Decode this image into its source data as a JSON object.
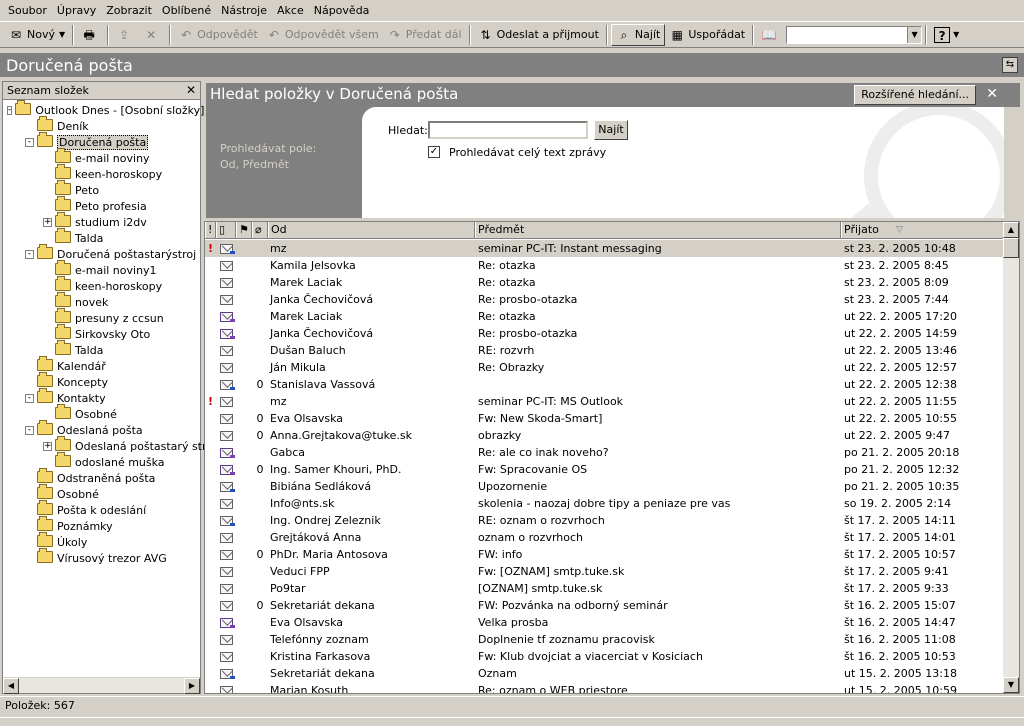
{
  "menu": [
    "Soubor",
    "Úpravy",
    "Zobrazit",
    "Oblíbené",
    "Nástroje",
    "Akce",
    "Nápověda"
  ],
  "toolbar": {
    "new_label": "Nový",
    "reply_label": "Odpovědět",
    "reply_all_label": "Odpovědět všem",
    "forward_label": "Předat dál",
    "send_receive_label": "Odeslat a přijmout",
    "find_label": "Najít",
    "organize_label": "Uspořádat",
    "address_combo_value": ""
  },
  "view_title": "Doručená pošta",
  "folder_pane": {
    "title": "Seznam složek",
    "items": [
      {
        "label": "Outlook Dnes - [Osobní složky]",
        "level": 0,
        "expander": "-",
        "icon": "outlook-today-icon"
      },
      {
        "label": "Deník",
        "level": 1,
        "expander": "",
        "icon": "journal-icon"
      },
      {
        "label": "Doručená pošta",
        "level": 1,
        "expander": "-",
        "icon": "inbox-icon",
        "selected": true
      },
      {
        "label": "e-mail noviny",
        "level": 2,
        "expander": "",
        "icon": "folder-icon"
      },
      {
        "label": "keen-horoskopy",
        "level": 2,
        "expander": "",
        "icon": "folder-icon"
      },
      {
        "label": "Peto",
        "level": 2,
        "expander": "",
        "icon": "folder-icon"
      },
      {
        "label": "Peto profesia",
        "level": 2,
        "expander": "",
        "icon": "folder-icon"
      },
      {
        "label": "studium i2dv",
        "level": 2,
        "expander": "+",
        "icon": "folder-icon"
      },
      {
        "label": "Talda",
        "level": 2,
        "expander": "",
        "icon": "folder-icon"
      },
      {
        "label": "Doručená poštastarýstroj",
        "level": 1,
        "expander": "-",
        "icon": "folder-icon"
      },
      {
        "label": "e-mail noviny1",
        "level": 2,
        "expander": "",
        "icon": "folder-icon"
      },
      {
        "label": "keen-horoskopy",
        "level": 2,
        "expander": "",
        "icon": "folder-icon"
      },
      {
        "label": "novek",
        "level": 2,
        "expander": "",
        "icon": "folder-icon"
      },
      {
        "label": "presuny z ccsun",
        "level": 2,
        "expander": "",
        "icon": "folder-icon"
      },
      {
        "label": "Sirkovsky Oto",
        "level": 2,
        "expander": "",
        "icon": "folder-icon"
      },
      {
        "label": "Talda",
        "level": 2,
        "expander": "",
        "icon": "folder-icon"
      },
      {
        "label": "Kalendář",
        "level": 1,
        "expander": "",
        "icon": "calendar-icon"
      },
      {
        "label": "Koncepty",
        "level": 1,
        "expander": "",
        "icon": "drafts-icon"
      },
      {
        "label": "Kontakty",
        "level": 1,
        "expander": "-",
        "icon": "contacts-icon"
      },
      {
        "label": "Osobné",
        "level": 2,
        "expander": "",
        "icon": "contacts-icon"
      },
      {
        "label": "Odeslaná pošta",
        "level": 1,
        "expander": "-",
        "icon": "folder-icon"
      },
      {
        "label": "Odeslaná poštastarý stro",
        "level": 2,
        "expander": "+",
        "icon": "folder-icon"
      },
      {
        "label": "odoslané muška",
        "level": 2,
        "expander": "",
        "icon": "folder-icon"
      },
      {
        "label": "Odstraněná pošta",
        "level": 1,
        "expander": "",
        "icon": "deleted-items-icon"
      },
      {
        "label": "Osobné",
        "level": 1,
        "expander": "",
        "icon": "contacts-icon"
      },
      {
        "label": "Pošta k odeslání",
        "level": 1,
        "expander": "",
        "icon": "outbox-icon"
      },
      {
        "label": "Poznámky",
        "level": 1,
        "expander": "",
        "icon": "notes-icon"
      },
      {
        "label": "Úkoly",
        "level": 1,
        "expander": "",
        "icon": "tasks-icon"
      },
      {
        "label": "Vírusový trezor AVG",
        "level": 1,
        "expander": "",
        "icon": "folder-icon"
      }
    ]
  },
  "find": {
    "title": "Hledat položky v Doručená pošta",
    "advanced_label": "Rozšířené hledání...",
    "search_in_label": "Prohledávat pole:",
    "search_in_fields": "Od, Předmět",
    "find_label": "Hledat:",
    "find_value": "",
    "find_button": "Najít",
    "fulltext_label": "Prohledávat celý text zprávy",
    "fulltext_checked": true
  },
  "columns": {
    "importance": "!",
    "icon": "",
    "flag": "",
    "attachment": "",
    "from": "Od",
    "subject": "Předmět",
    "received": "Přijato"
  },
  "messages": [
    {
      "imp": "!",
      "icon": "forwarded",
      "att": "",
      "from": "mz",
      "subject": "seminar PC-IT:  Instant messaging",
      "date": "st 23. 2. 2005 10:48",
      "selected": true
    },
    {
      "imp": "",
      "icon": "read",
      "att": "",
      "from": "Kamila Jelsovka",
      "subject": "Re: otazka",
      "date": "st 23. 2. 2005 8:45"
    },
    {
      "imp": "",
      "icon": "read",
      "att": "",
      "from": "Marek Laciak",
      "subject": "Re: otazka",
      "date": "st 23. 2. 2005 8:09"
    },
    {
      "imp": "",
      "icon": "read",
      "att": "",
      "from": "Janka Čechovičová",
      "subject": "Re: prosbo-otazka",
      "date": "st 23. 2. 2005 7:44"
    },
    {
      "imp": "",
      "icon": "replied",
      "att": "",
      "from": "Marek Laciak",
      "subject": "Re: otazka",
      "date": "ut 22. 2. 2005 17:20"
    },
    {
      "imp": "",
      "icon": "replied",
      "att": "",
      "from": "Janka Čechovičová",
      "subject": "Re: prosbo-otazka",
      "date": "ut 22. 2. 2005 14:59"
    },
    {
      "imp": "",
      "icon": "read",
      "att": "",
      "from": "Dušan Baluch",
      "subject": "RE: rozvrh",
      "date": "ut 22. 2. 2005 13:46"
    },
    {
      "imp": "",
      "icon": "read",
      "att": "",
      "from": "Ján Mikula",
      "subject": "Re: Obrazky",
      "date": "ut 22. 2. 2005 12:57"
    },
    {
      "imp": "",
      "icon": "forwarded",
      "att": "0",
      "from": "Stanislava Vassová",
      "subject": "",
      "date": "ut 22. 2. 2005 12:38"
    },
    {
      "imp": "!",
      "icon": "read",
      "att": "",
      "from": "mz",
      "subject": "seminar PC-IT: MS Outlook",
      "date": "ut 22. 2. 2005 11:55"
    },
    {
      "imp": "",
      "icon": "read",
      "att": "0",
      "from": "Eva Olsavska",
      "subject": "Fw: New Skoda-Smart]",
      "date": "ut 22. 2. 2005 10:55"
    },
    {
      "imp": "",
      "icon": "read",
      "att": "0",
      "from": "Anna.Grejtakova@tuke.sk",
      "subject": "obrazky",
      "date": "ut 22. 2. 2005 9:47"
    },
    {
      "imp": "",
      "icon": "replied",
      "att": "",
      "from": "Gabca",
      "subject": "Re: ale co inak noveho?",
      "date": "po 21. 2. 2005 20:18"
    },
    {
      "imp": "",
      "icon": "replied",
      "att": "0",
      "from": "Ing. Samer Khouri, PhD.",
      "subject": "Fw: Spracovanie OS",
      "date": "po 21. 2. 2005 12:32"
    },
    {
      "imp": "",
      "icon": "forwarded",
      "att": "",
      "from": "Bibiána Sedláková",
      "subject": "Upozornenie",
      "date": "po 21. 2. 2005 10:35"
    },
    {
      "imp": "",
      "icon": "read",
      "att": "",
      "from": "Info@nts.sk",
      "subject": "skolenia - naozaj dobre tipy a peniaze pre vas",
      "date": "so 19. 2. 2005 2:14"
    },
    {
      "imp": "",
      "icon": "forwarded",
      "att": "",
      "from": "Ing. Ondrej Zeleznik",
      "subject": "RE: oznam o rozvrhoch",
      "date": "št 17. 2. 2005 14:11"
    },
    {
      "imp": "",
      "icon": "read",
      "att": "",
      "from": "Grejtáková Anna",
      "subject": "oznam o rozvrhoch",
      "date": "št 17. 2. 2005 14:01"
    },
    {
      "imp": "",
      "icon": "read",
      "att": "0",
      "from": "PhDr. Maria Antosova",
      "subject": "FW: info",
      "date": "št 17. 2. 2005 10:57"
    },
    {
      "imp": "",
      "icon": "read",
      "att": "",
      "from": "Veduci FPP",
      "subject": "Fw: [OZNAM] smtp.tuke.sk",
      "date": "št 17. 2. 2005 9:41"
    },
    {
      "imp": "",
      "icon": "read",
      "att": "",
      "from": "Po9tar",
      "subject": "[OZNAM] smtp.tuke.sk",
      "date": "št 17. 2. 2005 9:33"
    },
    {
      "imp": "",
      "icon": "read",
      "att": "0",
      "from": "Sekretariát dekana",
      "subject": "FW: Pozvánka na odborný seminár",
      "date": "št 16. 2. 2005 15:07"
    },
    {
      "imp": "",
      "icon": "replied",
      "att": "",
      "from": "Eva Olsavska",
      "subject": "Velka prosba",
      "date": "št 16. 2. 2005 14:47"
    },
    {
      "imp": "",
      "icon": "read",
      "att": "",
      "from": "Telefónny zoznam",
      "subject": "Doplnenie tf zoznamu pracovisk",
      "date": "št 16. 2. 2005 11:08"
    },
    {
      "imp": "",
      "icon": "read",
      "att": "",
      "from": "Kristina Farkasova",
      "subject": "Fw: Klub dvojciat a viacerciat v Kosiciach",
      "date": "št 16. 2. 2005 10:53"
    },
    {
      "imp": "",
      "icon": "forwarded",
      "att": "",
      "from": "Sekretariát dekana",
      "subject": "Oznam",
      "date": "ut 15. 2. 2005 13:18"
    },
    {
      "imp": "",
      "icon": "read",
      "att": "",
      "from": "Marian Kosuth",
      "subject": "Re: oznam o WEB priestore",
      "date": "ut 15. 2. 2005 10:59"
    }
  ],
  "status": {
    "items_label": "Položek: 567"
  }
}
